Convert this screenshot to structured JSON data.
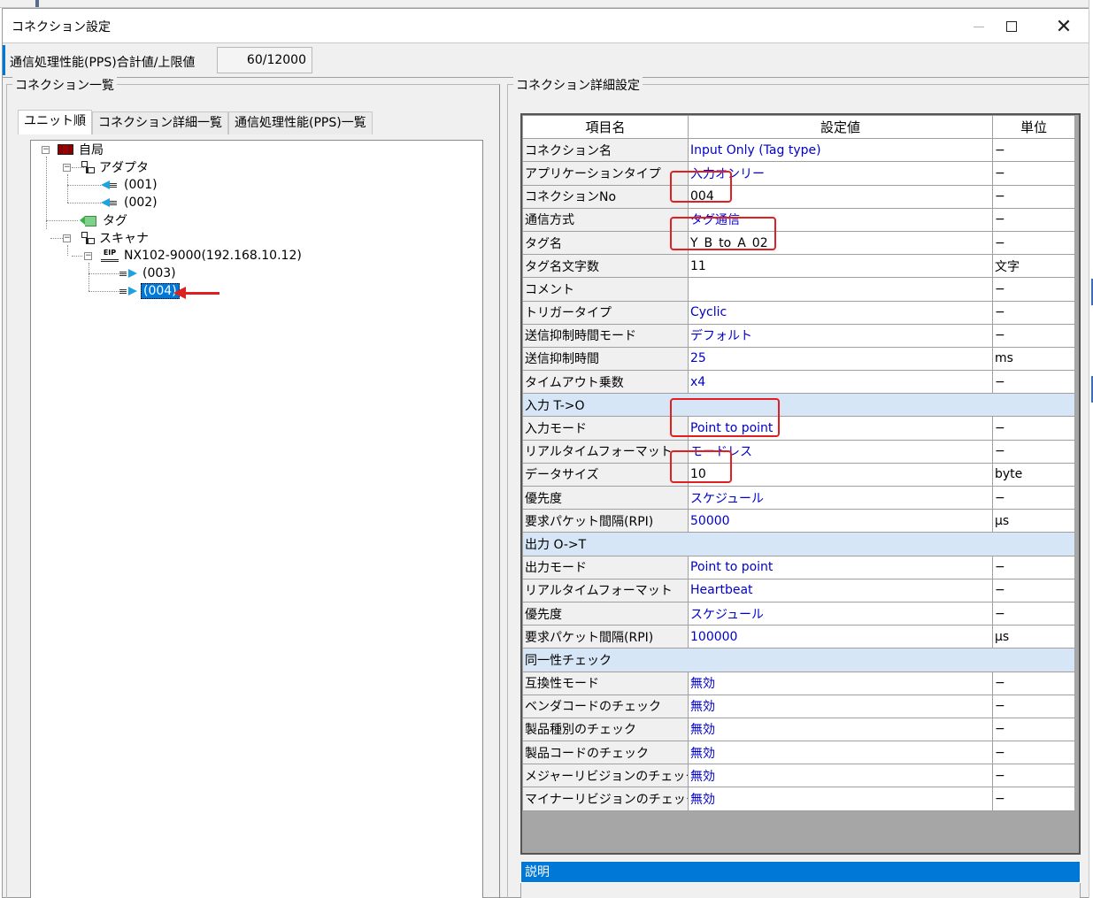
{
  "window": {
    "title": "コネクション設定"
  },
  "pps": {
    "label": "通信処理性能(PPS)合計値/上限値",
    "value": "60/12000"
  },
  "left_panel": {
    "group_label": "コネクション一覧",
    "tabs": [
      {
        "label": "ユニット順",
        "active": true
      },
      {
        "label": "コネクション詳細一覧",
        "active": false
      },
      {
        "label": "通信処理性能(PPS)一覧",
        "active": false
      }
    ],
    "tree": {
      "root": "自局",
      "adapter": "アダプタ",
      "adapter_children": [
        "(001)",
        "(002)"
      ],
      "tag": "タグ",
      "scanner": "スキャナ",
      "device": "NX102-9000(192.168.10.12)",
      "device_icon_text": "EIP",
      "device_children": [
        "(003)",
        "(004)"
      ],
      "selected": "(004)"
    }
  },
  "right_panel": {
    "group_label": "コネクション詳細設定",
    "headers": {
      "name": "項目名",
      "value": "設定値",
      "unit": "単位"
    },
    "rows": [
      {
        "name": "コネクション名",
        "value": "Input Only (Tag type)",
        "unit": "−"
      },
      {
        "name": "アプリケーションタイプ",
        "value": "入力オンリー",
        "unit": "−"
      },
      {
        "name": "コネクションNo",
        "value": "004",
        "unit": "−",
        "editable": true
      },
      {
        "name": "通信方式",
        "value": "タグ通信",
        "unit": "−"
      },
      {
        "name": "タグ名",
        "value": "Y_B_to_A_02",
        "unit": "−",
        "editable": true
      },
      {
        "name": "タグ名文字数",
        "value": "11",
        "unit": "文字",
        "editable": true
      },
      {
        "name": "コメント",
        "value": "",
        "unit": "−",
        "editable": true
      },
      {
        "name": "トリガータイプ",
        "value": "Cyclic",
        "unit": "−"
      },
      {
        "name": "送信抑制時間モード",
        "value": "デフォルト",
        "unit": "−"
      },
      {
        "name": "送信抑制時間",
        "value": "25",
        "unit": "ms"
      },
      {
        "name": "タイムアウト乗数",
        "value": "x4",
        "unit": "−"
      },
      {
        "section": "入力 T->O"
      },
      {
        "name": "入力モード",
        "value": "Point to point",
        "unit": "−"
      },
      {
        "name": "リアルタイムフォーマット",
        "value": "モードレス",
        "unit": "−"
      },
      {
        "name": "データサイズ",
        "value": "10",
        "unit": "byte",
        "editable": true
      },
      {
        "name": "優先度",
        "value": "スケジュール",
        "unit": "−"
      },
      {
        "name": "要求パケット間隔(RPI)",
        "value": "50000",
        "unit": "μs"
      },
      {
        "section": "出力 O->T"
      },
      {
        "name": "出力モード",
        "value": "Point to point",
        "unit": "−"
      },
      {
        "name": "リアルタイムフォーマット",
        "value": "Heartbeat",
        "unit": "−"
      },
      {
        "name": "優先度",
        "value": "スケジュール",
        "unit": "−"
      },
      {
        "name": "要求パケット間隔(RPI)",
        "value": "100000",
        "unit": "μs"
      },
      {
        "section": "同一性チェック"
      },
      {
        "name": "互換性モード",
        "value": "無効",
        "unit": "−"
      },
      {
        "name": "ベンダコードのチェック",
        "value": "無効",
        "unit": "−"
      },
      {
        "name": "製品種別のチェック",
        "value": "無効",
        "unit": "−"
      },
      {
        "name": "製品コードのチェック",
        "value": "無効",
        "unit": "−"
      },
      {
        "name": "メジャーリビジョンのチェック",
        "value": "無効",
        "unit": "−"
      },
      {
        "name": "マイナーリビジョンのチェック",
        "value": "無効",
        "unit": "−"
      }
    ],
    "description_label": "説明"
  },
  "colors": {
    "accent": "#0078d7",
    "value_text": "#0000cc",
    "section_bg": "#d6e6f7",
    "highlight": "#e02020"
  }
}
